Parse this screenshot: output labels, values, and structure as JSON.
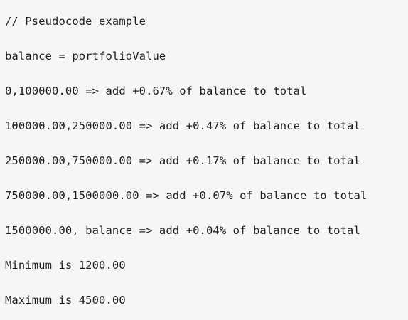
{
  "code": {
    "lines": [
      "// Pseudocode example",
      "balance = portfolioValue",
      "0,100000.00 => add +0.67% of balance to total",
      "100000.00,250000.00 => add +0.47% of balance to total",
      "250000.00,750000.00 => add +0.17% of balance to total",
      "750000.00,1500000.00 => add +0.07% of balance to total",
      "1500000.00, balance => add +0.04% of balance to total",
      "Minimum is 1200.00",
      "Maximum is 4500.00"
    ]
  },
  "colors": {
    "background": "#f6f6f6",
    "text": "#1f1f1f"
  }
}
